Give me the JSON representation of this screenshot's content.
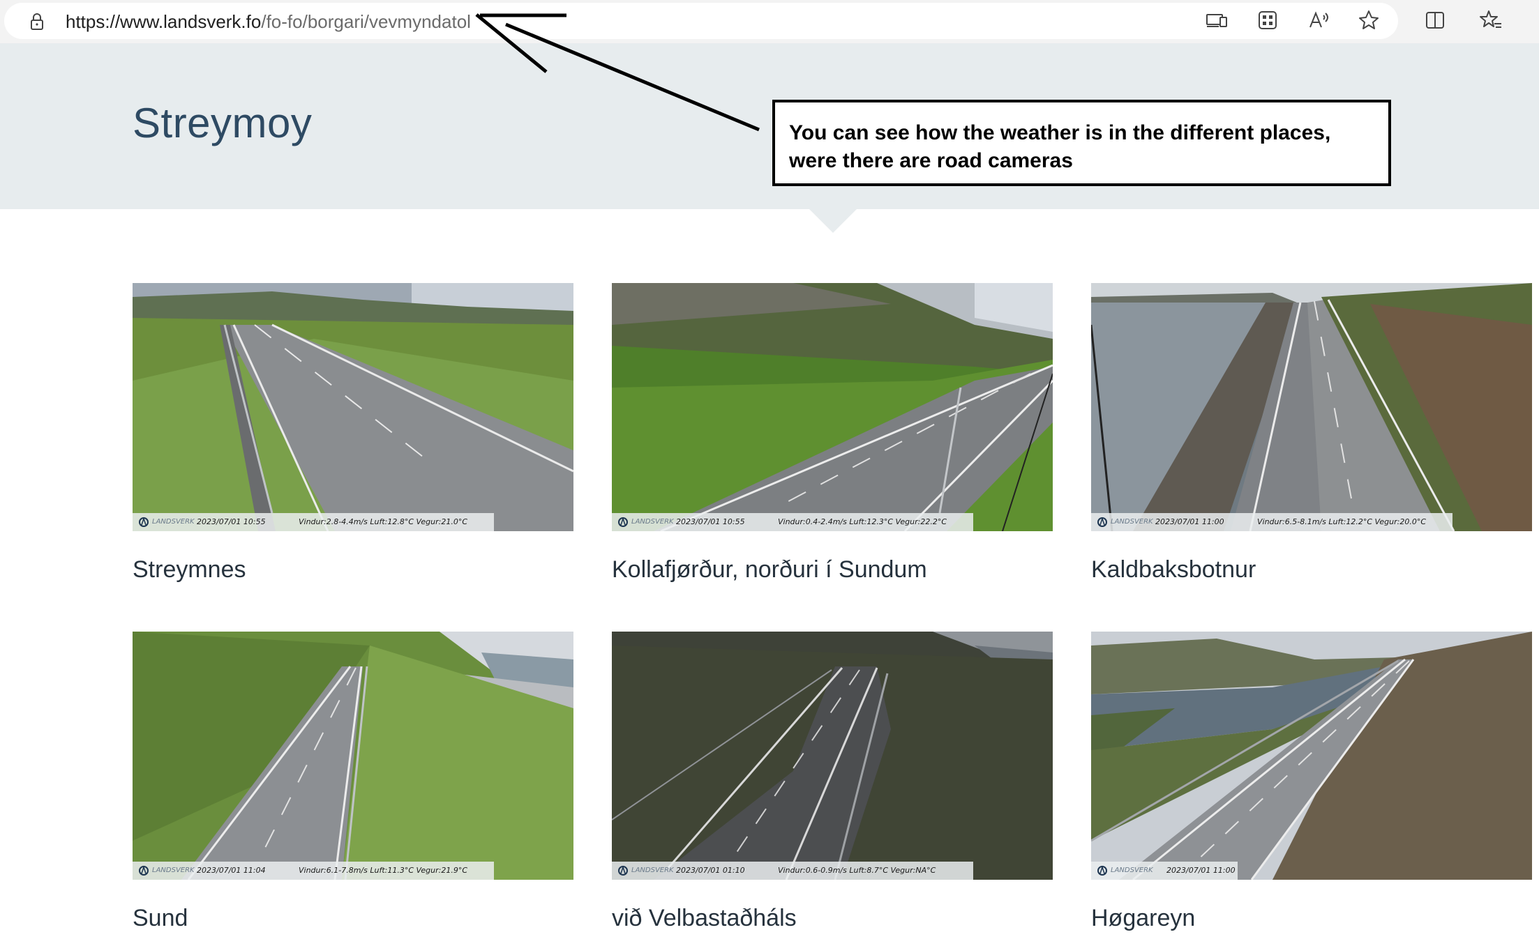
{
  "browser": {
    "url_host": "https://www.landsverk.fo",
    "url_path": "/fo-fo/borgari/vevmyndatol"
  },
  "page": {
    "title": "Streymoy"
  },
  "annotation": {
    "text": "You can see how the weather is in the different places, were there are road cameras"
  },
  "cameras": [
    {
      "name": "Streymnes",
      "brand": "LANDSVERK",
      "timestamp": "2023/07/01 10:55",
      "weather": "Vindur:2.8-4.4m/s Luft:12.8°C Vegur:21.0°C"
    },
    {
      "name": "Kollafjørður, norðuri í Sundum",
      "brand": "LANDSVERK",
      "timestamp": "2023/07/01 10:55",
      "weather": "Vindur:0.4-2.4m/s Luft:12.3°C Vegur:22.2°C"
    },
    {
      "name": "Kaldbaksbotnur",
      "brand": "LANDSVERK",
      "timestamp": "2023/07/01 11:00",
      "weather": "Vindur:6.5-8.1m/s Luft:12.2°C Vegur:20.0°C"
    },
    {
      "name": "Sund",
      "brand": "LANDSVERK",
      "timestamp": "2023/07/01 11:04",
      "weather": "Vindur:6.1-7.8m/s Luft:11.3°C Vegur:21.9°C"
    },
    {
      "name": "við Velbastaðháls",
      "brand": "LANDSVERK",
      "timestamp": "2023/07/01 01:10",
      "weather": "Vindur:0.6-0.9m/s Luft:8.7°C Vegur:NA°C"
    },
    {
      "name": "Høgareyn",
      "brand": "LANDSVERK",
      "timestamp": "2023/07/01 11:00",
      "weather": ""
    }
  ],
  "icons": {
    "lock": "lock-icon",
    "devices": "device-icon",
    "apps": "apps-icon",
    "read_aloud": "read-aloud-icon",
    "favorite": "star-icon",
    "split_screen": "split-screen-icon",
    "favorites_bar": "favorites-icon"
  },
  "colors": {
    "header_band": "#e7ecee",
    "title": "#2e4a63",
    "annotation_border": "#000000"
  }
}
